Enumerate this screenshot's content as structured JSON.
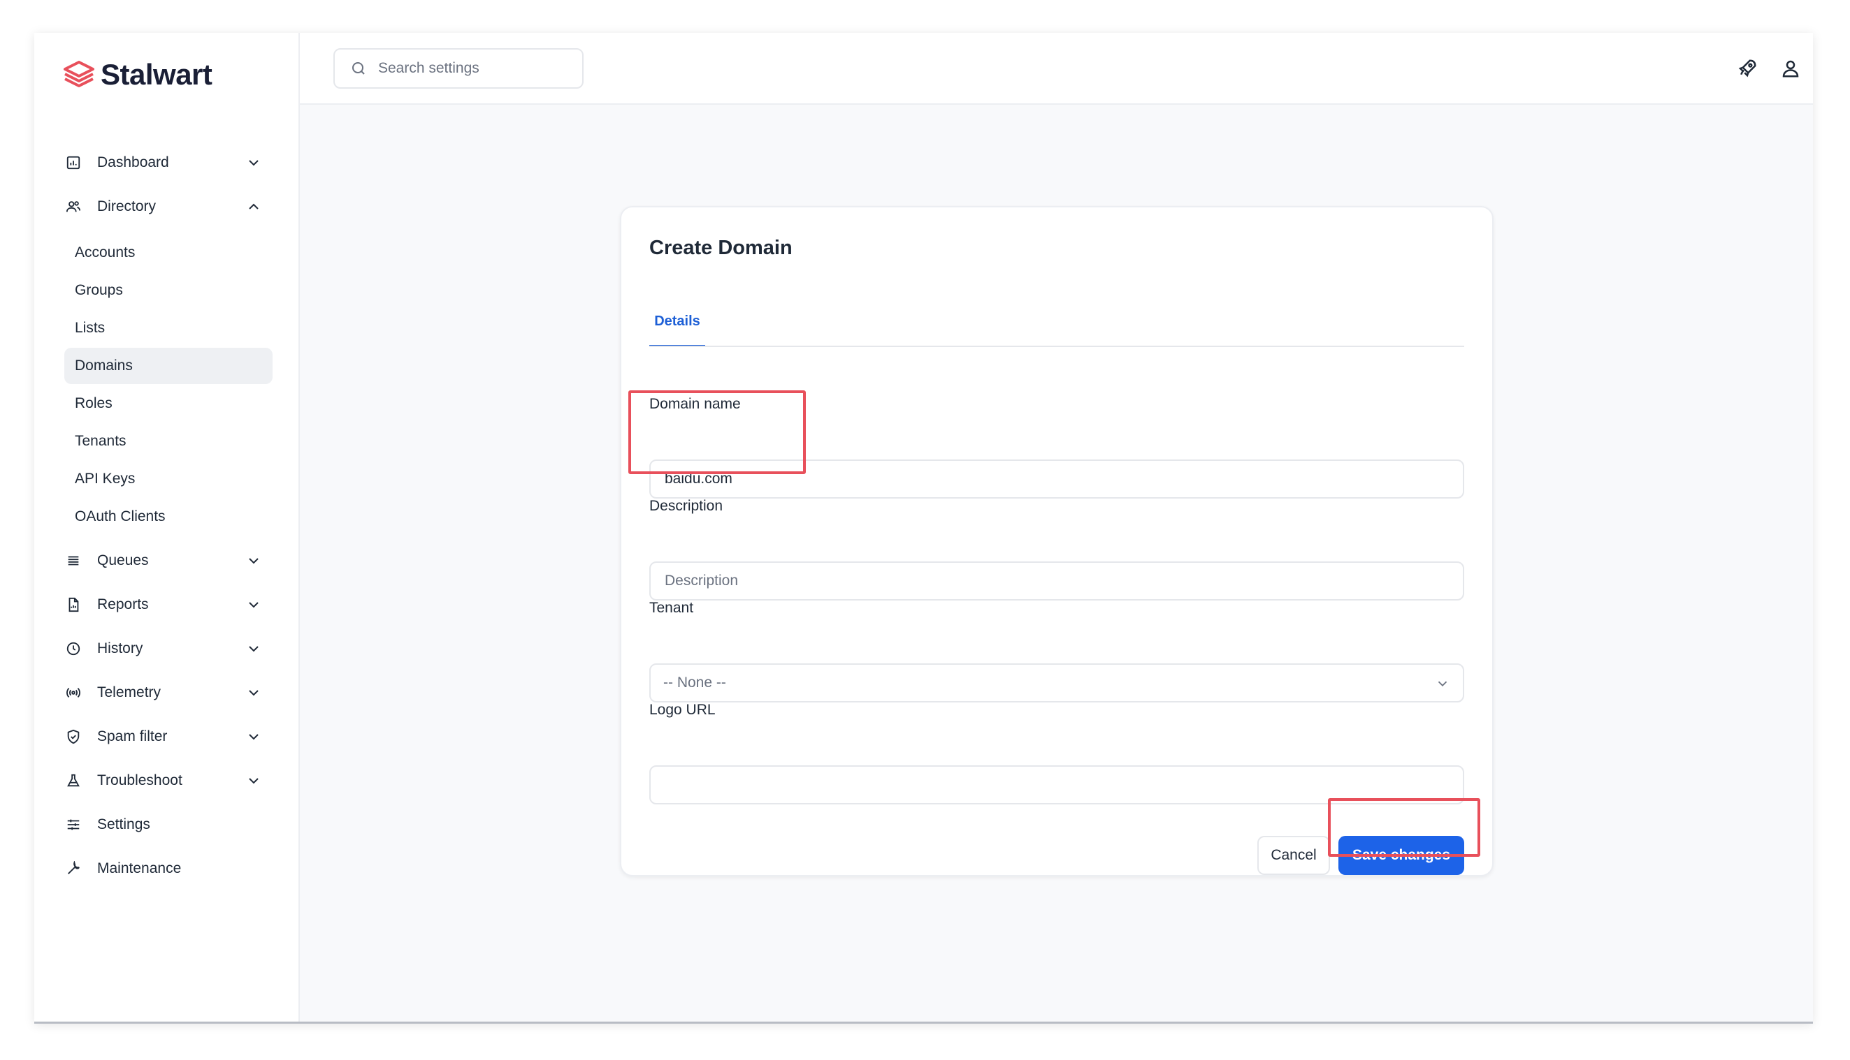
{
  "app": {
    "name": "Stalwart",
    "brand_color": "#e8505b",
    "accent_color": "#1d63e8"
  },
  "search": {
    "placeholder": "Search settings",
    "icon": "search-icon"
  },
  "topbar": {
    "icons": [
      "rocket-icon",
      "user-icon"
    ]
  },
  "sidebar": {
    "items": [
      {
        "label": "Dashboard",
        "icon": "dashboard-icon",
        "expanded": false
      },
      {
        "label": "Directory",
        "icon": "directory-icon",
        "expanded": true
      },
      {
        "label": "Queues",
        "icon": "queues-icon",
        "expanded": false
      },
      {
        "label": "Reports",
        "icon": "reports-icon",
        "expanded": false
      },
      {
        "label": "History",
        "icon": "history-icon",
        "expanded": false
      },
      {
        "label": "Telemetry",
        "icon": "telemetry-icon",
        "expanded": false
      },
      {
        "label": "Spam filter",
        "icon": "shield-icon",
        "expanded": false
      },
      {
        "label": "Troubleshoot",
        "icon": "flask-icon",
        "expanded": false
      },
      {
        "label": "Settings",
        "icon": "sliders-icon"
      },
      {
        "label": "Maintenance",
        "icon": "wrench-icon"
      }
    ],
    "directory_items": [
      {
        "label": "Accounts"
      },
      {
        "label": "Groups"
      },
      {
        "label": "Lists"
      },
      {
        "label": "Domains",
        "active": true
      },
      {
        "label": "Roles"
      },
      {
        "label": "Tenants"
      },
      {
        "label": "API Keys"
      },
      {
        "label": "OAuth Clients"
      }
    ]
  },
  "form": {
    "title": "Create Domain",
    "tabs": [
      {
        "label": "Details",
        "active": true
      }
    ],
    "fields": {
      "domain_name": {
        "label": "Domain name",
        "value": "baidu.com",
        "placeholder": ""
      },
      "description": {
        "label": "Description",
        "value": "",
        "placeholder": "Description"
      },
      "tenant": {
        "label": "Tenant",
        "value": "-- None --"
      },
      "logo_url": {
        "label": "Logo URL",
        "value": "",
        "placeholder": ""
      }
    },
    "cancel_label": "Cancel",
    "save_label": "Save changes"
  }
}
